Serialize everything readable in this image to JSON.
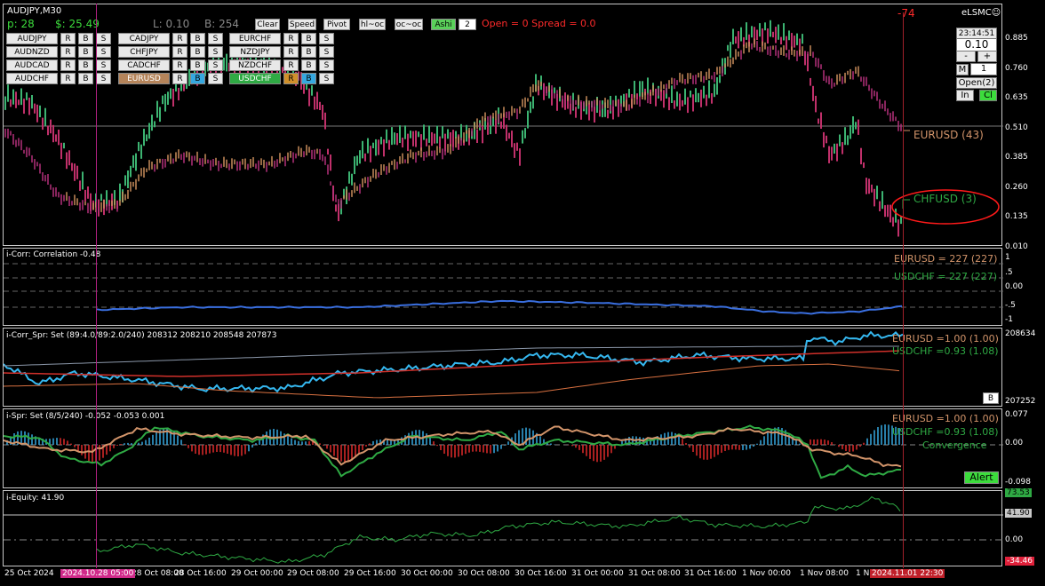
{
  "chart": {
    "symbol_title": "AUDJPY,M30",
    "brand": "eLSMC",
    "stats": {
      "p": "p: 28",
      "dollars": "$: 25.49",
      "l": "L: 0.10",
      "b": "B: 254"
    },
    "toolbar": {
      "clear": "Clear",
      "speed": "Speed",
      "pivot": "Pivot",
      "hl_oc": "hl~oc",
      "oc_oc": "oc~oc",
      "ashi": "Ashi",
      "ashi_value": "2",
      "open_spread": "Open = 0   Spread = 0.0"
    },
    "bar_countdown": "-74",
    "pair_grid": [
      [
        "AUDJPY",
        "CADJPY",
        "EURCHF"
      ],
      [
        "AUDNZD",
        "CHFJPY",
        "NZDJPY"
      ],
      [
        "AUDCAD",
        "CADCHF",
        "NZDCHF"
      ],
      [
        "AUDCHF",
        "EURUSD",
        "USDCHF"
      ]
    ],
    "pair_buttons": [
      "R",
      "B",
      "S"
    ],
    "side_panel": {
      "clock": "23:14:51",
      "lot": "0.10",
      "minus": "-",
      "plus": "+",
      "m_label": "M",
      "m_value": "1",
      "open_label": "Open(2)",
      "in_label": "In",
      "cl_label": "Cl"
    },
    "main_scale": [
      "0.885",
      "0.760",
      "0.635",
      "0.510",
      "0.385",
      "0.260",
      "0.135",
      "0.010"
    ],
    "overlay_labels": {
      "eurusd": "EURUSD (43)",
      "chfusd": "CHFUSD (3)"
    }
  },
  "panes": {
    "corr": {
      "title": "i-Corr: Correlation -0.48",
      "labels": [
        "EURUSD = 227 (227)",
        "USDCHF = 227 (227)"
      ],
      "scale": [
        "1",
        ".5",
        "0.00",
        "-.5",
        "-1"
      ]
    },
    "corr_spr": {
      "title": "i-Corr_Spr: Set (89:4.0/89:2.0/240) 208312 208210 208548 207873",
      "labels": [
        "EURUSD =1.00 (1.00)",
        "USDCHF =0.93 (1.08)"
      ],
      "scale_top": "208634",
      "scale_bottom": "207252",
      "b_button": "B"
    },
    "spr": {
      "title": "i-Spr: Set (8/5/240) -0.052 -0.053 0.001",
      "labels": [
        "EURUSD =1.00 (1.00)",
        "USDCHF =0.93 (1.08)"
      ],
      "convergence": "Convergence",
      "alert": "Alert",
      "scale": [
        "0.077",
        "0.00",
        "-0.098"
      ]
    },
    "equity": {
      "title": "i-Equity: 41.90",
      "scale_top": "73.53",
      "scale_mid": "41.90",
      "scale_zero": "0.00",
      "scale_bottom": "-34.46"
    }
  },
  "time_axis": {
    "labels": [
      "25 Oct 2024",
      "28 Oct 08:00",
      "28 Oct 16:00",
      "29 Oct 00:00",
      "29 Oct 08:00",
      "29 Oct 16:00",
      "30 Oct 00:00",
      "30 Oct 08:00",
      "30 Oct 16:00",
      "31 Oct 00:00",
      "31 Oct 08:00",
      "31 Oct 16:00",
      "1 Nov 00:00",
      "1 Nov 08:00",
      "1 N"
    ],
    "highlight_left": "2024.10.28 05:00",
    "highlight_right": "2024.11.01 22:30"
  },
  "colors": {
    "up_candle": "#3cb371",
    "down_candle": "#c0306a",
    "eurusd": "#d2946a",
    "usdchf": "#2faa44",
    "blue_line": "#3a6fe0",
    "cyan_line": "#35b8f0",
    "red_text": "#ff2a2a",
    "marker": "#d02a8a"
  }
}
